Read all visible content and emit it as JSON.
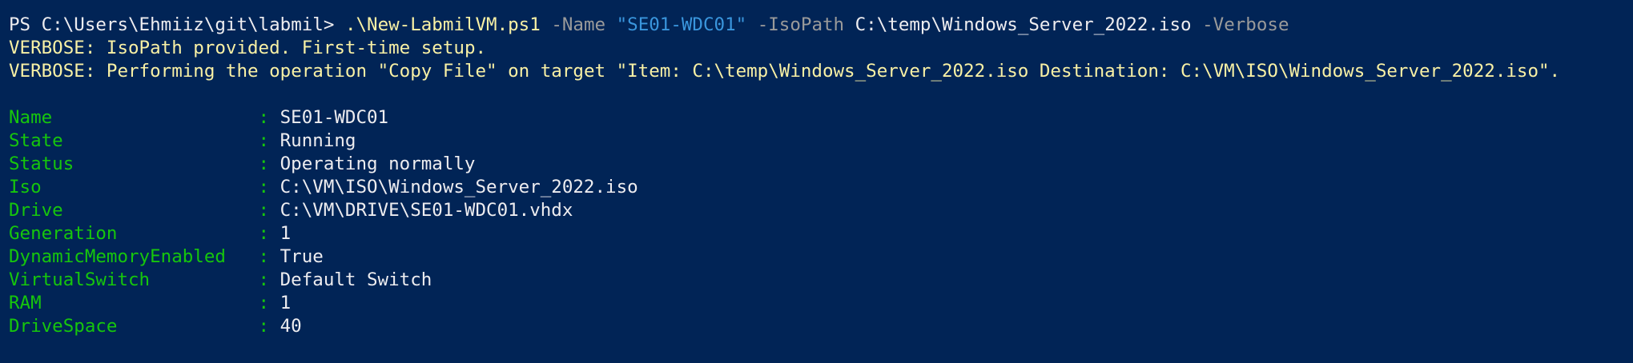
{
  "command_line": {
    "prompt": "PS C:\\Users\\Ehmiiz\\git\\labmil>",
    "script": ".\\New-LabmilVM.ps1",
    "name_param": "-Name",
    "name_value": "\"SE01-WDC01\"",
    "isopath_param": "-IsoPath",
    "isopath_value": "C:\\temp\\Windows_Server_2022.iso",
    "verbose_flag": "-Verbose"
  },
  "verbose_lines": [
    "VERBOSE: IsoPath provided. First-time setup.",
    "VERBOSE: Performing the operation \"Copy File\" on target \"Item: C:\\temp\\Windows_Server_2022.iso Destination: C:\\VM\\ISO\\Windows_Server_2022.iso\"."
  ],
  "separator": ":",
  "properties": [
    {
      "name": "Name",
      "value": "SE01-WDC01"
    },
    {
      "name": "State",
      "value": "Running"
    },
    {
      "name": "Status",
      "value": "Operating normally"
    },
    {
      "name": "Iso",
      "value": "C:\\VM\\ISO\\Windows_Server_2022.iso"
    },
    {
      "name": "Drive",
      "value": "C:\\VM\\DRIVE\\SE01-WDC01.vhdx"
    },
    {
      "name": "Generation",
      "value": "1"
    },
    {
      "name": "DynamicMemoryEnabled",
      "value": "True"
    },
    {
      "name": "VirtualSwitch",
      "value": "Default Switch"
    },
    {
      "name": "RAM",
      "value": "1"
    },
    {
      "name": "DriveSpace",
      "value": "40"
    }
  ],
  "colors": {
    "background": "#012456",
    "foreground": "#eeedf0",
    "command": "#f9f1a5",
    "parameter": "#9a9a9a",
    "string": "#3a96dd",
    "property_name": "#16c60c",
    "verbose": "#f9f1a5"
  }
}
